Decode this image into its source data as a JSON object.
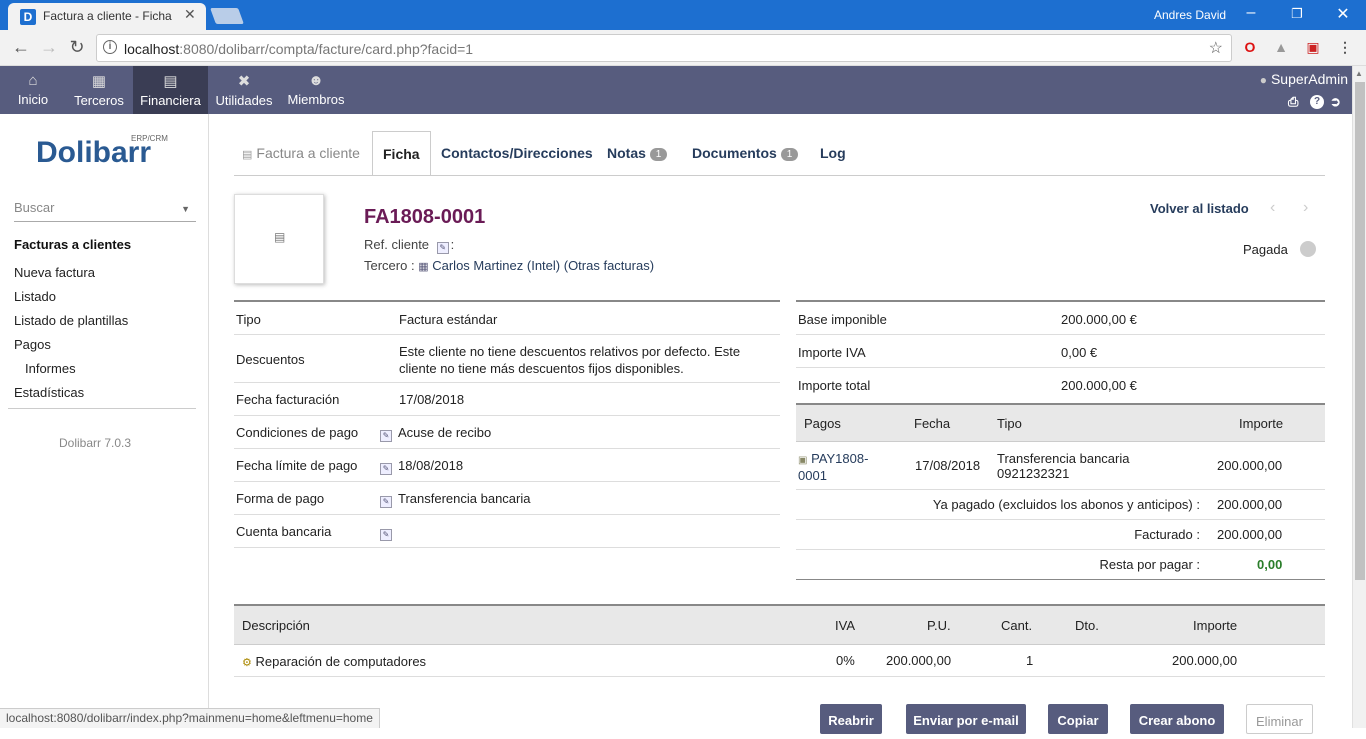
{
  "browser": {
    "tab_title": "Factura a cliente - Ficha",
    "tab_close": "✕",
    "user": "Andres David",
    "url_host": "localhost",
    "url_rest": ":8080/dolibarr/compta/facture/card.php?facid=1",
    "status_url": "localhost:8080/dolibarr/index.php?mainmenu=home&leftmenu=home"
  },
  "topmenu": {
    "items": [
      {
        "label": "Inicio",
        "icon": "home-icon"
      },
      {
        "label": "Terceros",
        "icon": "companies-icon"
      },
      {
        "label": "Financiera",
        "icon": "billing-icon"
      },
      {
        "label": "Utilidades",
        "icon": "tools-icon"
      },
      {
        "label": "Miembros",
        "icon": "members-icon"
      }
    ],
    "user": "SuperAdmin"
  },
  "leftmenu": {
    "logo": "Dolibarr",
    "logo_sup": "ERP/CRM",
    "search_placeholder": "Buscar",
    "section_title": "Facturas a clientes",
    "links": [
      "Nueva factura",
      "Listado",
      "Listado de plantillas",
      "Pagos",
      "Informes",
      "Estadísticas"
    ],
    "version": "Dolibarr 7.0.3"
  },
  "tabs": [
    {
      "label": "Factura a cliente"
    },
    {
      "label": "Ficha"
    },
    {
      "label": "Contactos/Direcciones"
    },
    {
      "label": "Notas",
      "badge": "1"
    },
    {
      "label": "Documentos",
      "badge": "1"
    },
    {
      "label": "Log"
    }
  ],
  "invoice": {
    "ref": "FA1808-0001",
    "ref_cliente_label": "Ref. cliente",
    "tercero_label": "Tercero :",
    "tercero_name": "Carlos Martinez (Intel)",
    "other_invoices": "(Otras facturas)",
    "back_link": "Volver al listado",
    "status": "Pagada"
  },
  "left_fields": [
    {
      "label": "Tipo",
      "value": "Factura estándar",
      "edit": false
    },
    {
      "label": "Descuentos",
      "value": "Este cliente no tiene descuentos relativos por defecto. Este cliente no tiene más descuentos fijos disponibles.",
      "edit": false
    },
    {
      "label": "Fecha facturación",
      "value": "17/08/2018",
      "edit": false
    },
    {
      "label": "Condiciones de pago",
      "value": "Acuse de recibo",
      "edit": true
    },
    {
      "label": "Fecha límite de pago",
      "value": "18/08/2018",
      "edit": true
    },
    {
      "label": "Forma de pago",
      "value": "Transferencia bancaria",
      "edit": true
    },
    {
      "label": "Cuenta bancaria",
      "value": "",
      "edit": true
    }
  ],
  "right_fields": [
    {
      "label": "Base imponible",
      "value": "200.000,00 €"
    },
    {
      "label": "Importe IVA",
      "value": "0,00 €"
    },
    {
      "label": "Importe total",
      "value": "200.000,00 €"
    }
  ],
  "payments": {
    "headers": [
      "Pagos",
      "Fecha",
      "Tipo",
      "Importe"
    ],
    "row": {
      "ref_1": "PAY1808-",
      "ref_2": "0001",
      "date": "17/08/2018",
      "type_1": "Transferencia bancaria",
      "type_2": "0921232321",
      "amount": "200.000,00"
    },
    "ya_pagado_label": "Ya pagado (excluidos los abonos y anticipos) :",
    "ya_pagado": "200.000,00",
    "facturado_label": "Facturado :",
    "facturado": "200.000,00",
    "resta_label": "Resta por pagar :",
    "resta": "0,00"
  },
  "lines": {
    "headers": [
      "Descripción",
      "IVA",
      "P.U.",
      "Cant.",
      "Dto.",
      "Importe"
    ],
    "rows": [
      {
        "desc": "Reparación de computadores",
        "iva": "0%",
        "pu": "200.000,00",
        "qty": "1",
        "dto": "",
        "amount": "200.000,00"
      }
    ]
  },
  "actions": [
    "Reabrir",
    "Enviar por e-mail",
    "Copiar",
    "Crear abono",
    "Eliminar"
  ],
  "colors": {
    "brand": "#575c7e",
    "ref": "#6a1b56",
    "link": "#263c5c",
    "paid": "#2a7d2a"
  }
}
